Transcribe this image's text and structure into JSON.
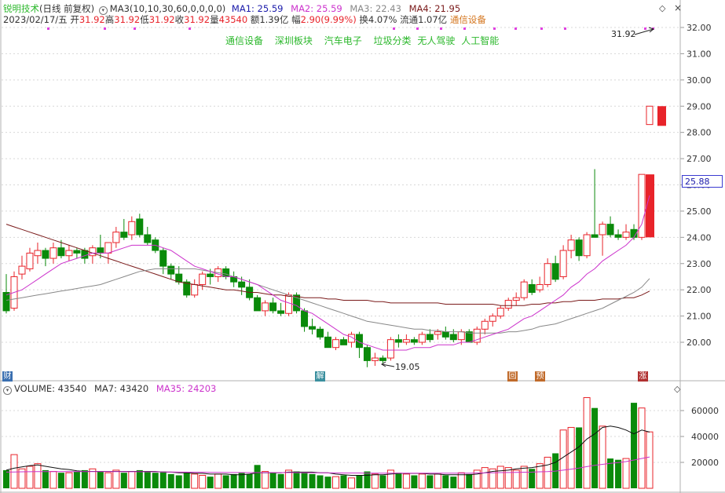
{
  "header": {
    "stock_name": "锐明技术",
    "period": "(日线 前复权)",
    "ma_label": "MA3(10,10,30,60,0,0,0,0)",
    "ma1": "MA1: 25.59",
    "ma2": "MA2: 25.59",
    "ma3": "MA3: 22.43",
    "ma4": "MA4: 21.95",
    "date": "2023/02/17/五",
    "open_label": "开",
    "open": "31.92",
    "high_label": "高",
    "high": "31.92",
    "low_label": "低",
    "low": "31.92",
    "close_label": "收",
    "close": "31.92",
    "vol_label": "量",
    "vol": "43540",
    "amount": "额1.39亿",
    "change_label": "幅",
    "change": "2.90(9.99%)",
    "turnover": "换4.07%",
    "float": "流通1.07亿",
    "industry": "通信设备"
  },
  "concept_tags": [
    "通信设备",
    "深圳板块",
    "汽车电子",
    "垃圾分类",
    "无人驾驶",
    "人工智能"
  ],
  "annotations": {
    "high_price": "31.92",
    "low_price": "19.05",
    "current_price_tag": "25.88"
  },
  "event_markers": [
    {
      "text": "财",
      "color": "#3a6fb0"
    },
    {
      "text": "解",
      "color": "#3a8f9e"
    },
    {
      "text": "回",
      "color": "#c06a2a"
    },
    {
      "text": "预",
      "color": "#c06a2a"
    },
    {
      "text": "涨",
      "color": "#b03030"
    }
  ],
  "volume_header": {
    "label": "VOLUME: 43540",
    "ma7": "MA7: 43420",
    "ma35": "MA35: 24203"
  },
  "colors": {
    "up": "#e8232a",
    "down": "#0a8a0a",
    "ma1": "#cc33cc",
    "ma2": "#7a1a1a",
    "ma3": "#888888",
    "vol_ma7": "#111111",
    "tag_green": "#2db82d",
    "industry_orange": "#d4761f"
  },
  "price_axis": {
    "min": 19.0,
    "max": 32.0,
    "ticks": [
      "32.00",
      "31.00",
      "30.00",
      "29.00",
      "28.00",
      "27.00",
      "26.00",
      "25.00",
      "24.00",
      "23.00",
      "22.00",
      "21.00",
      "20.00"
    ]
  },
  "volume_axis": {
    "ticks": [
      "60000",
      "40000",
      "20000"
    ]
  },
  "chart_data": {
    "type": "candlestick",
    "ohlc": [
      [
        21.9,
        22.6,
        21.1,
        21.2,
        14000
      ],
      [
        21.3,
        22.7,
        21.2,
        22.5,
        26000
      ],
      [
        22.6,
        23.3,
        22.4,
        22.9,
        15000
      ],
      [
        22.8,
        23.6,
        22.7,
        23.4,
        17000
      ],
      [
        23.3,
        23.8,
        23.0,
        23.5,
        19000
      ],
      [
        23.5,
        23.6,
        22.9,
        23.2,
        14000
      ],
      [
        23.2,
        23.8,
        23.0,
        23.6,
        13000
      ],
      [
        23.6,
        23.9,
        23.2,
        23.3,
        12000
      ],
      [
        23.3,
        23.7,
        23.1,
        23.5,
        12000
      ],
      [
        23.5,
        23.6,
        23.2,
        23.4,
        13000
      ],
      [
        23.5,
        23.6,
        23.0,
        23.2,
        14000
      ],
      [
        23.3,
        23.7,
        23.0,
        23.6,
        15000
      ],
      [
        23.6,
        24.1,
        23.2,
        23.4,
        13000
      ],
      [
        23.4,
        23.8,
        23.0,
        23.8,
        12000
      ],
      [
        23.8,
        24.4,
        23.6,
        24.2,
        14000
      ],
      [
        24.2,
        24.7,
        23.9,
        24.0,
        12000
      ],
      [
        24.1,
        24.8,
        23.9,
        24.6,
        13000
      ],
      [
        24.7,
        24.9,
        24.0,
        24.1,
        14000
      ],
      [
        24.1,
        24.4,
        23.7,
        23.8,
        13000
      ],
      [
        23.9,
        24.0,
        23.4,
        23.5,
        12000
      ],
      [
        23.5,
        23.6,
        22.6,
        22.9,
        13000
      ],
      [
        22.9,
        23.0,
        22.4,
        22.6,
        11000
      ],
      [
        22.6,
        22.9,
        22.2,
        22.3,
        10000
      ],
      [
        22.3,
        22.4,
        21.7,
        21.8,
        12000
      ],
      [
        21.8,
        22.4,
        21.7,
        22.2,
        11000
      ],
      [
        22.2,
        22.7,
        22.0,
        22.6,
        10000
      ],
      [
        22.6,
        22.8,
        22.2,
        22.5,
        9000
      ],
      [
        22.5,
        22.9,
        22.3,
        22.8,
        11000
      ],
      [
        22.8,
        22.9,
        22.4,
        22.5,
        10000
      ],
      [
        22.5,
        22.7,
        22.1,
        22.3,
        11000
      ],
      [
        22.3,
        22.5,
        21.8,
        22.1,
        12000
      ],
      [
        22.1,
        22.4,
        21.6,
        21.7,
        11000
      ],
      [
        21.7,
        21.8,
        21.2,
        21.2,
        18000
      ],
      [
        21.2,
        21.6,
        21.0,
        21.5,
        13000
      ],
      [
        21.5,
        21.7,
        21.1,
        21.2,
        12000
      ],
      [
        21.2,
        21.5,
        21.0,
        21.1,
        11000
      ],
      [
        21.1,
        21.9,
        21.0,
        21.8,
        14000
      ],
      [
        21.8,
        21.9,
        21.1,
        21.2,
        13000
      ],
      [
        21.2,
        21.3,
        20.4,
        20.6,
        12000
      ],
      [
        20.6,
        20.9,
        20.3,
        20.5,
        11000
      ],
      [
        20.5,
        20.6,
        20.1,
        20.2,
        10000
      ],
      [
        20.2,
        20.4,
        19.8,
        19.8,
        9000
      ],
      [
        19.8,
        20.2,
        19.7,
        20.1,
        9000
      ],
      [
        20.1,
        20.2,
        19.9,
        19.9,
        10000
      ],
      [
        20.0,
        20.4,
        19.8,
        20.3,
        8000
      ],
      [
        20.3,
        20.4,
        19.4,
        19.8,
        10000
      ],
      [
        19.8,
        19.9,
        19.05,
        19.3,
        13000
      ],
      [
        19.3,
        19.6,
        19.1,
        19.4,
        11000
      ],
      [
        19.4,
        19.5,
        19.2,
        19.3,
        10000
      ],
      [
        19.4,
        20.2,
        19.3,
        20.1,
        14000
      ],
      [
        20.1,
        20.3,
        19.8,
        20.0,
        12000
      ],
      [
        20.0,
        20.3,
        19.9,
        20.1,
        11000
      ],
      [
        20.1,
        20.2,
        19.9,
        20.0,
        10000
      ],
      [
        20.0,
        20.4,
        19.9,
        20.3,
        11000
      ],
      [
        20.3,
        20.5,
        20.0,
        20.1,
        10000
      ],
      [
        20.3,
        20.5,
        20.1,
        20.4,
        11000
      ],
      [
        20.4,
        20.6,
        20.1,
        20.2,
        10000
      ],
      [
        20.3,
        20.5,
        20.0,
        20.1,
        9000
      ],
      [
        20.1,
        20.5,
        19.9,
        20.4,
        12000
      ],
      [
        20.4,
        20.5,
        20.0,
        20.0,
        11000
      ],
      [
        20.0,
        20.6,
        19.9,
        20.5,
        14000
      ],
      [
        20.5,
        20.9,
        20.3,
        20.8,
        16000
      ],
      [
        20.8,
        21.1,
        20.6,
        21.0,
        15000
      ],
      [
        21.0,
        21.4,
        20.9,
        21.3,
        17000
      ],
      [
        21.3,
        21.7,
        21.2,
        21.6,
        16000
      ],
      [
        21.6,
        21.9,
        21.4,
        21.7,
        14000
      ],
      [
        21.7,
        22.4,
        21.6,
        22.3,
        17000
      ],
      [
        22.2,
        22.4,
        21.8,
        21.9,
        15000
      ],
      [
        22.0,
        22.5,
        21.9,
        22.2,
        19000
      ],
      [
        22.2,
        23.2,
        22.1,
        23.0,
        24000
      ],
      [
        23.0,
        23.3,
        22.3,
        22.4,
        27000
      ],
      [
        22.5,
        23.7,
        22.4,
        23.5,
        45000
      ],
      [
        23.5,
        24.1,
        23.2,
        23.9,
        47000
      ],
      [
        23.9,
        24.0,
        23.1,
        23.3,
        47000
      ],
      [
        23.3,
        24.2,
        23.2,
        24.1,
        70000
      ],
      [
        24.1,
        26.6,
        24.0,
        24.0,
        62000
      ],
      [
        24.1,
        24.6,
        23.3,
        24.5,
        48000
      ],
      [
        24.5,
        24.8,
        24.0,
        24.1,
        23000
      ],
      [
        24.1,
        24.3,
        23.9,
        24.0,
        22000
      ],
      [
        24.0,
        24.5,
        23.9,
        24.2,
        23000
      ],
      [
        24.3,
        24.5,
        23.9,
        24.0,
        66000
      ],
      [
        24.0,
        26.4,
        23.9,
        26.4,
        62000
      ],
      [
        28.3,
        29.0,
        28.3,
        29.0,
        43540
      ]
    ],
    "ma1_values": [
      21.8,
      21.9,
      22.0,
      22.2,
      22.4,
      22.6,
      22.8,
      23.0,
      23.1,
      23.2,
      23.3,
      23.4,
      23.4,
      23.4,
      23.5,
      23.6,
      23.7,
      23.7,
      23.7,
      23.7,
      23.6,
      23.5,
      23.3,
      23.1,
      22.9,
      22.8,
      22.7,
      22.6,
      22.5,
      22.5,
      22.4,
      22.3,
      22.2,
      22.0,
      21.8,
      21.6,
      21.5,
      21.4,
      21.2,
      21.1,
      20.9,
      20.7,
      20.5,
      20.3,
      20.2,
      20.0,
      19.9,
      19.8,
      19.7,
      19.7,
      19.7,
      19.7,
      19.8,
      19.8,
      19.8,
      19.9,
      19.9,
      19.9,
      20.0,
      20.0,
      20.1,
      20.2,
      20.3,
      20.4,
      20.5,
      20.7,
      20.9,
      21.0,
      21.2,
      21.4,
      21.6,
      21.8,
      22.1,
      22.3,
      22.6,
      22.8,
      23.1,
      23.3,
      23.5,
      23.7,
      24.0,
      24.5,
      25.6
    ],
    "ma2_values": [
      24.5,
      24.4,
      24.3,
      24.2,
      24.1,
      24.0,
      23.9,
      23.8,
      23.7,
      23.6,
      23.5,
      23.4,
      23.3,
      23.2,
      23.1,
      23.0,
      22.9,
      22.8,
      22.7,
      22.6,
      22.5,
      22.4,
      22.3,
      22.25,
      22.2,
      22.15,
      22.1,
      22.05,
      22.0,
      22.0,
      21.95,
      21.9,
      21.9,
      21.85,
      21.8,
      21.8,
      21.75,
      21.75,
      21.7,
      21.7,
      21.7,
      21.65,
      21.65,
      21.6,
      21.6,
      21.6,
      21.6,
      21.55,
      21.55,
      21.5,
      21.5,
      21.5,
      21.5,
      21.5,
      21.5,
      21.5,
      21.45,
      21.45,
      21.45,
      21.45,
      21.45,
      21.45,
      21.45,
      21.4,
      21.4,
      21.4,
      21.4,
      21.45,
      21.45,
      21.5,
      21.5,
      21.55,
      21.55,
      21.6,
      21.6,
      21.6,
      21.65,
      21.65,
      21.65,
      21.7,
      21.7,
      21.8,
      21.95
    ],
    "ma3_values": [
      21.6,
      21.65,
      21.7,
      21.75,
      21.8,
      21.85,
      21.9,
      21.95,
      22.0,
      22.05,
      22.1,
      22.15,
      22.2,
      22.3,
      22.4,
      22.5,
      22.6,
      22.7,
      22.75,
      22.8,
      22.8,
      22.8,
      22.8,
      22.8,
      22.8,
      22.75,
      22.7,
      22.65,
      22.6,
      22.5,
      22.4,
      22.3,
      22.2,
      22.1,
      22.0,
      21.9,
      21.8,
      21.7,
      21.6,
      21.5,
      21.4,
      21.3,
      21.2,
      21.1,
      21.0,
      20.9,
      20.8,
      20.75,
      20.7,
      20.65,
      20.6,
      20.55,
      20.5,
      20.5,
      20.45,
      20.45,
      20.4,
      20.4,
      20.4,
      20.35,
      20.35,
      20.35,
      20.35,
      20.35,
      20.4,
      20.4,
      20.45,
      20.5,
      20.6,
      20.65,
      20.7,
      20.8,
      20.9,
      21.0,
      21.1,
      21.2,
      21.3,
      21.45,
      21.6,
      21.75,
      21.9,
      22.1,
      22.43
    ],
    "vol_ma7_values": [
      14000,
      15500,
      16500,
      17500,
      18000,
      17000,
      16000,
      15000,
      14500,
      13500,
      13000,
      13000,
      13000,
      13000,
      13000,
      13000,
      13000,
      13000,
      13000,
      13000,
      12500,
      12500,
      12000,
      12000,
      11500,
      11500,
      11000,
      11000,
      11000,
      10500,
      10500,
      11000,
      12000,
      12000,
      12000,
      12000,
      12500,
      12500,
      12500,
      12500,
      12000,
      12000,
      11000,
      10500,
      10000,
      10000,
      10000,
      10500,
      10500,
      11000,
      11500,
      11500,
      11500,
      11500,
      11000,
      11000,
      10500,
      10500,
      10500,
      10500,
      11000,
      12000,
      13000,
      13500,
      14000,
      15000,
      15500,
      16000,
      17000,
      18000,
      20000,
      24000,
      28000,
      32000,
      38000,
      42000,
      47000,
      48000,
      47000,
      45000,
      42000,
      45000,
      43420
    ],
    "vol_ma35_values": [
      12500,
      12600,
      12700,
      12800,
      12900,
      12900,
      12900,
      12900,
      12900,
      12900,
      12900,
      12900,
      12900,
      12900,
      12900,
      12800,
      12800,
      12800,
      12700,
      12700,
      12600,
      12600,
      12500,
      12500,
      12400,
      12400,
      12300,
      12300,
      12200,
      12200,
      12100,
      12100,
      12100,
      12100,
      12100,
      12100,
      12100,
      12100,
      12000,
      12000,
      12000,
      11900,
      11900,
      11800,
      11800,
      11800,
      11700,
      11700,
      11700,
      11700,
      11700,
      11700,
      11700,
      11700,
      11700,
      11700,
      11700,
      11700,
      11700,
      11700,
      11800,
      11900,
      12000,
      12100,
      12200,
      12300,
      12400,
      12500,
      12700,
      12900,
      13300,
      14000,
      14800,
      15600,
      16700,
      17700,
      18500,
      19200,
      19900,
      20600,
      21800,
      23000,
      24203
    ]
  }
}
